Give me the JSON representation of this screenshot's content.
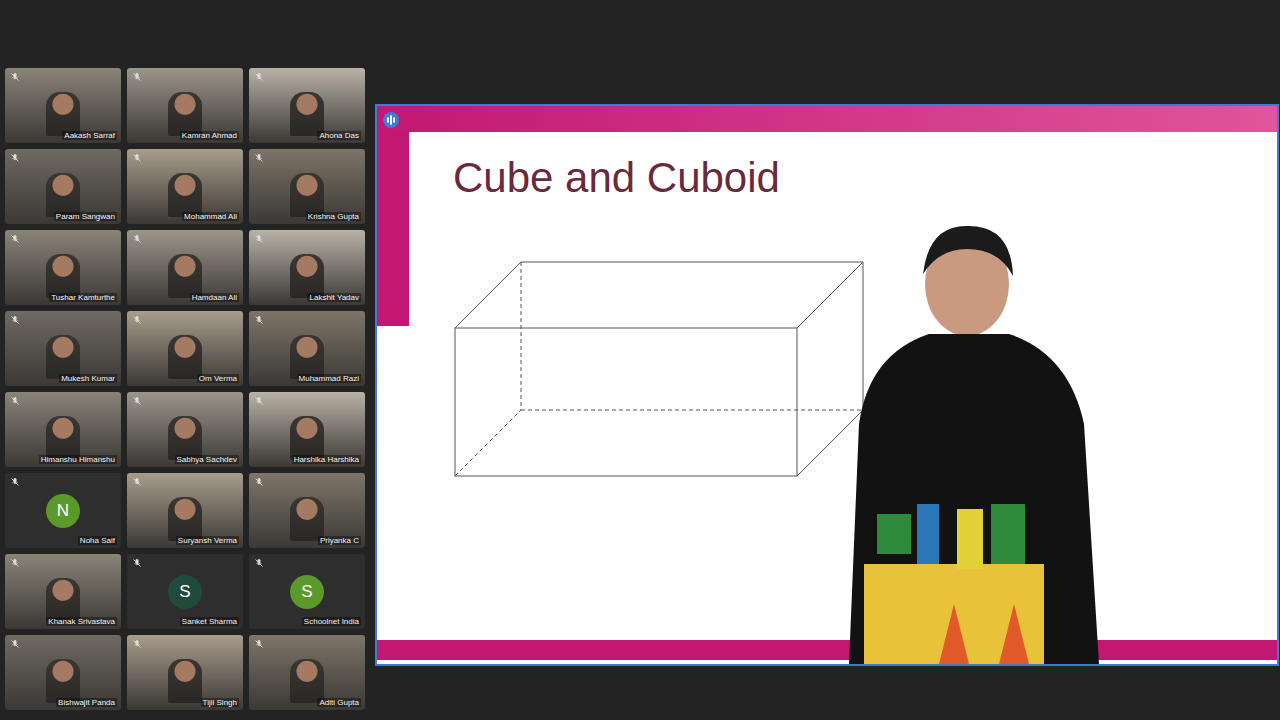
{
  "meeting": {
    "participants": [
      {
        "name": "Aakash Sarraf",
        "muted": true,
        "kind": "video",
        "initial": "",
        "color": ""
      },
      {
        "name": "Kamran Ahmad",
        "muted": true,
        "kind": "video",
        "initial": "",
        "color": ""
      },
      {
        "name": "Ahona Das",
        "muted": true,
        "kind": "video",
        "initial": "",
        "color": ""
      },
      {
        "name": "Param Sangwan",
        "muted": true,
        "kind": "video",
        "initial": "",
        "color": ""
      },
      {
        "name": "Mohammad Ali",
        "muted": true,
        "kind": "video",
        "initial": "",
        "color": ""
      },
      {
        "name": "Krishna Gupta",
        "muted": true,
        "kind": "video",
        "initial": "",
        "color": ""
      },
      {
        "name": "Tushar Kamturthe",
        "muted": true,
        "kind": "video",
        "initial": "",
        "color": ""
      },
      {
        "name": "Hamdaan Ali",
        "muted": true,
        "kind": "video",
        "initial": "",
        "color": ""
      },
      {
        "name": "Lakshit Yadav",
        "muted": true,
        "kind": "video",
        "initial": "",
        "color": ""
      },
      {
        "name": "Mukesh Kumar",
        "muted": true,
        "kind": "video",
        "initial": "",
        "color": ""
      },
      {
        "name": "Om Verma",
        "muted": true,
        "kind": "video",
        "initial": "",
        "color": ""
      },
      {
        "name": "Muhammad Razi",
        "muted": true,
        "kind": "video",
        "initial": "",
        "color": ""
      },
      {
        "name": "Himanshu Himanshu",
        "muted": true,
        "kind": "video",
        "initial": "",
        "color": ""
      },
      {
        "name": "Sabhya Sachdev",
        "muted": true,
        "kind": "video",
        "initial": "",
        "color": ""
      },
      {
        "name": "Harshika Harshika",
        "muted": true,
        "kind": "video",
        "initial": "",
        "color": ""
      },
      {
        "name": "Noha Saif",
        "muted": true,
        "kind": "avatar",
        "initial": "N",
        "color": "#5a9a2a"
      },
      {
        "name": "Suryansh Verma",
        "muted": true,
        "kind": "video",
        "initial": "",
        "color": ""
      },
      {
        "name": "Priyanka C",
        "muted": true,
        "kind": "video",
        "initial": "",
        "color": ""
      },
      {
        "name": "Khanak Srivastava",
        "muted": true,
        "kind": "video",
        "initial": "",
        "color": ""
      },
      {
        "name": "Sanket Sharma",
        "muted": true,
        "kind": "avatar",
        "initial": "S",
        "color": "#1f4a3c"
      },
      {
        "name": "Schoolnet India",
        "muted": true,
        "kind": "avatar",
        "initial": "S",
        "color": "#5a9a2a"
      },
      {
        "name": "Bishwajit Panda",
        "muted": true,
        "kind": "video",
        "initial": "",
        "color": ""
      },
      {
        "name": "Tijil Singh",
        "muted": true,
        "kind": "video",
        "initial": "",
        "color": ""
      },
      {
        "name": "Aditi Gupta",
        "muted": true,
        "kind": "video",
        "initial": "",
        "color": ""
      }
    ]
  },
  "presentation": {
    "speaking": true,
    "slide": {
      "title": "Cube and Cuboid"
    }
  }
}
